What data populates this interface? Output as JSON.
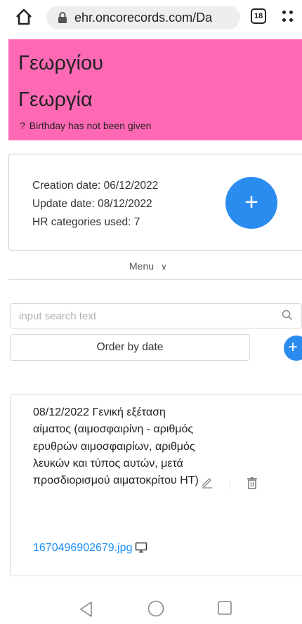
{
  "browser": {
    "url": "ehr.oncorecords.com/Da",
    "tab_count": "18"
  },
  "patient": {
    "surname": "Γεωργίου",
    "name": "Γεωργία",
    "birthday_icon": "?",
    "birthday_text": "Birthday has not been given",
    "header_color": "#ff69b4"
  },
  "info": {
    "creation": "Creation date: 06/12/2022",
    "update": "Update date: 08/12/2022",
    "categories": "HR categories used: 7",
    "add_icon": "+",
    "accent_color": "#2b8cf0"
  },
  "menu": {
    "label": "Menu",
    "chevron": "∨"
  },
  "search": {
    "placeholder": "input search text",
    "value": ""
  },
  "order": {
    "label": "Order by date"
  },
  "side_add_icon": "+",
  "record": {
    "text": "08/12/2022 Γενική εξέταση αίματος (αιμοσφαιρίνη - αριθμός ερυθρών αιμοσφαιρίων, αριθμός λευκών και τύπος αυτών, μετά προσδιορισμού αιματοκρίτου HT)",
    "file": "1670496902679.jpg",
    "link_color": "#1890ff"
  },
  "icons": [
    "home-icon",
    "lock-icon",
    "tabs-icon",
    "more-icon",
    "plus-icon",
    "search-icon",
    "monitor-icon",
    "edit-icon",
    "delete-icon",
    "back-icon",
    "home-circle-icon",
    "recents-icon"
  ]
}
